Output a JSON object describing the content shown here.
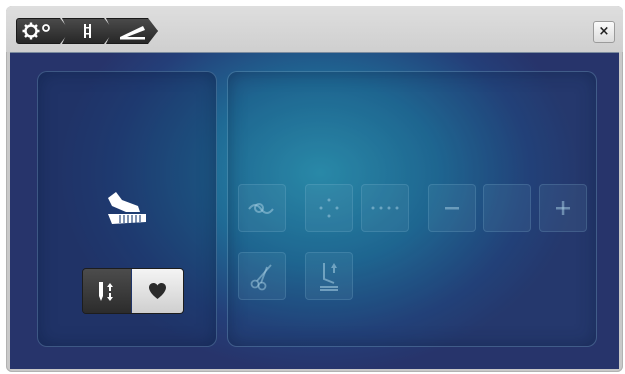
{
  "window": {
    "close_label": "×"
  },
  "breadcrumbs": [
    {
      "icon": "gear-setup-icon"
    },
    {
      "icon": "needle-icon"
    },
    {
      "icon": "foot-control-icon"
    }
  ],
  "left_panel": {
    "pedal_icon": "foot-pedal-icon",
    "toggle": {
      "options": [
        {
          "icon": "needle-up-down-icon",
          "selected": true
        },
        {
          "icon": "heart-icon",
          "selected": false
        }
      ]
    }
  },
  "right_panel": {
    "functions": [
      {
        "icon": "thread-knot-icon",
        "enabled": false
      },
      {
        "icon": "dots-cross-icon",
        "enabled": false
      },
      {
        "icon": "dots-row-icon",
        "enabled": false
      },
      {
        "icon": "minus-icon",
        "enabled": false
      },
      {
        "icon": "blank-icon",
        "enabled": false
      },
      {
        "icon": "plus-icon",
        "enabled": false
      },
      {
        "icon": "scissors-icon",
        "enabled": false
      },
      {
        "icon": "presser-foot-up-icon",
        "enabled": false
      }
    ]
  }
}
